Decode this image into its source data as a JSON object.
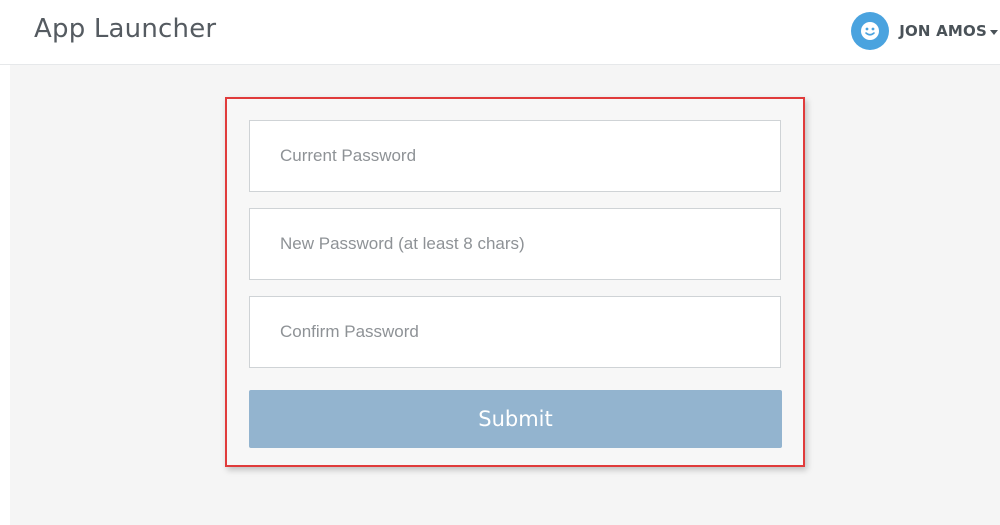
{
  "header": {
    "app_title": "App Launcher",
    "user": {
      "name": "JON AMOS",
      "avatar_icon": "smiley-face-icon",
      "avatar_color": "#4aa3df"
    }
  },
  "form": {
    "current_password_placeholder": "Current Password",
    "new_password_placeholder": "New Password (at least 8 chars)",
    "confirm_password_placeholder": "Confirm Password",
    "submit_label": "Submit",
    "submit_color": "#93b4cf",
    "highlight_color": "#e03b3b"
  }
}
